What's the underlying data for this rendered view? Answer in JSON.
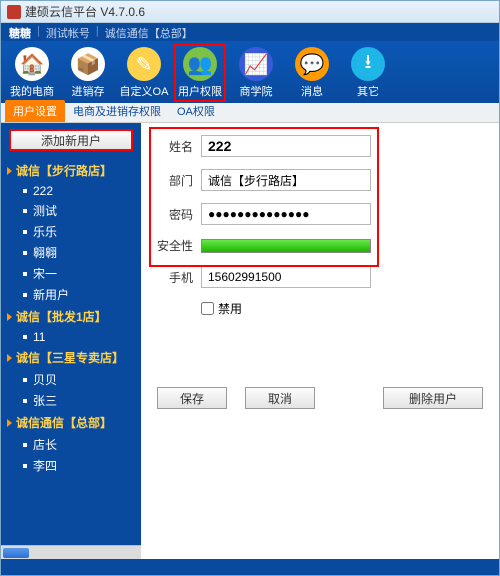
{
  "title": "建硕云信平台  V4.7.0.6",
  "subbar": {
    "a": "糖糖",
    "b": "测试帐号",
    "c": "诚信通信【总部】"
  },
  "toolbar": [
    {
      "key": "shop",
      "label": "我的电商",
      "bg": "#ffffff",
      "glyph": "🏠"
    },
    {
      "key": "stock",
      "label": "进销存",
      "bg": "#ffffff",
      "glyph": "📦"
    },
    {
      "key": "oa",
      "label": "自定义OA",
      "bg": "#ffd24d",
      "glyph": "✎"
    },
    {
      "key": "perm",
      "label": "用户权限",
      "bg": "#7cc14a",
      "glyph": "👥"
    },
    {
      "key": "school",
      "label": "商学院",
      "bg": "#3a5bd9",
      "glyph": "📈"
    },
    {
      "key": "msg",
      "label": "消息",
      "bg": "#ff9a00",
      "glyph": "💬"
    },
    {
      "key": "other",
      "label": "其它",
      "bg": "#1eb6e6",
      "glyph": "⭳"
    }
  ],
  "toolbar_selected": "perm",
  "tabs": [
    {
      "key": "usr",
      "label": "用户设置",
      "active": true
    },
    {
      "key": "ec",
      "label": "电商及进销存权限"
    },
    {
      "key": "oa",
      "label": "OA权限"
    }
  ],
  "add_user_label": "添加新用户",
  "tree": [
    {
      "type": "group",
      "label": "诚信【步行路店】"
    },
    {
      "type": "leaf",
      "label": "222"
    },
    {
      "type": "leaf",
      "label": "测试"
    },
    {
      "type": "leaf",
      "label": "乐乐"
    },
    {
      "type": "leaf",
      "label": "翱翱"
    },
    {
      "type": "leaf",
      "label": "宋一"
    },
    {
      "type": "leaf",
      "label": "新用户"
    },
    {
      "type": "group",
      "label": "诚信【批发1店】"
    },
    {
      "type": "leaf",
      "label": "11"
    },
    {
      "type": "group",
      "label": "诚信【三星专卖店】"
    },
    {
      "type": "leaf",
      "label": "贝贝"
    },
    {
      "type": "leaf",
      "label": "张三"
    },
    {
      "type": "group",
      "label": "诚信通信【总部】"
    },
    {
      "type": "leaf",
      "label": "店长"
    },
    {
      "type": "leaf",
      "label": "李四"
    }
  ],
  "form": {
    "name_label": "姓名",
    "name_value": "222",
    "dept_label": "部门",
    "dept_value": "诚信【步行路店】",
    "pwd_label": "密码",
    "pwd_value": "●●●●●●●●●●●●●●",
    "sec_label": "安全性",
    "phone_label": "手机",
    "phone_value": "15602991500",
    "disable_label": "禁用"
  },
  "buttons": {
    "save": "保存",
    "cancel": "取消",
    "delete": "删除用户"
  }
}
